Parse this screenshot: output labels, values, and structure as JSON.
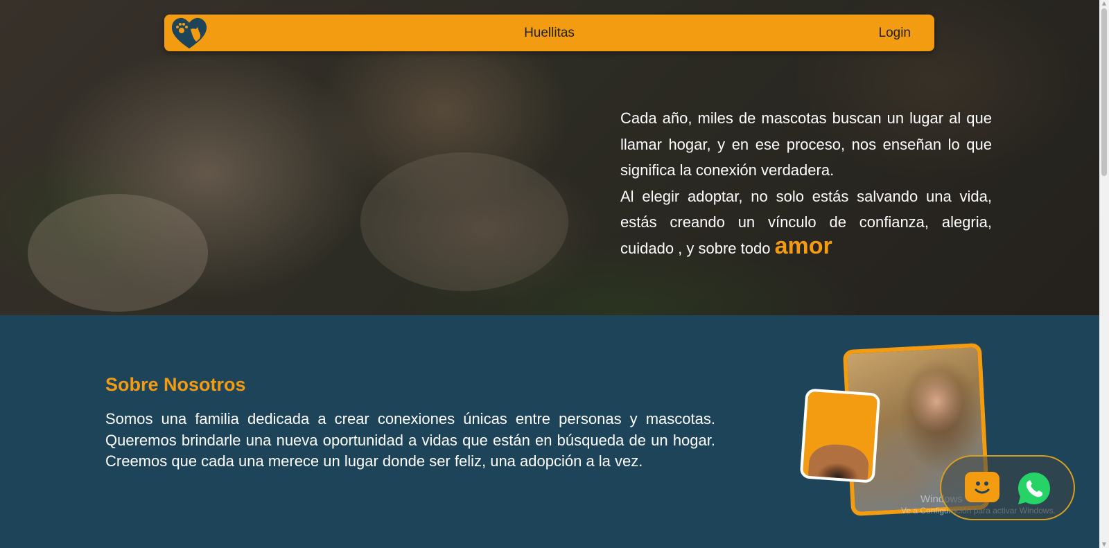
{
  "navbar": {
    "brand": "Huellitas",
    "login_label": "Login"
  },
  "hero": {
    "paragraph1": "Cada año, miles de mascotas buscan un lugar al que llamar hogar, y en ese proceso, nos enseñan lo que significa la conexión verdadera.",
    "paragraph2": "Al elegir adoptar, no solo estás salvando una vida, estás creando un vínculo de confianza, alegria, cuidado , y sobre todo",
    "highlight": "amor"
  },
  "about": {
    "title": "Sobre Nosotros",
    "text": "Somos una familia dedicada a crear conexiones únicas entre personas y mascotas. Queremos brindarle una nueva oportunidad a vidas que están en búsqueda de un hogar. Creemos que cada una merece un lugar donde ser feliz, una adopción a la vez."
  },
  "watermark": {
    "title": "Windows",
    "subtitle": "Ve a Configuración para activar Windows."
  },
  "colors": {
    "accent": "#f39c12",
    "section_bg": "#1e4459",
    "whatsapp": "#25d366"
  },
  "icons": {
    "logo": "heart-paw-logo",
    "chat": "chatbot-icon",
    "whatsapp": "whatsapp-icon"
  }
}
